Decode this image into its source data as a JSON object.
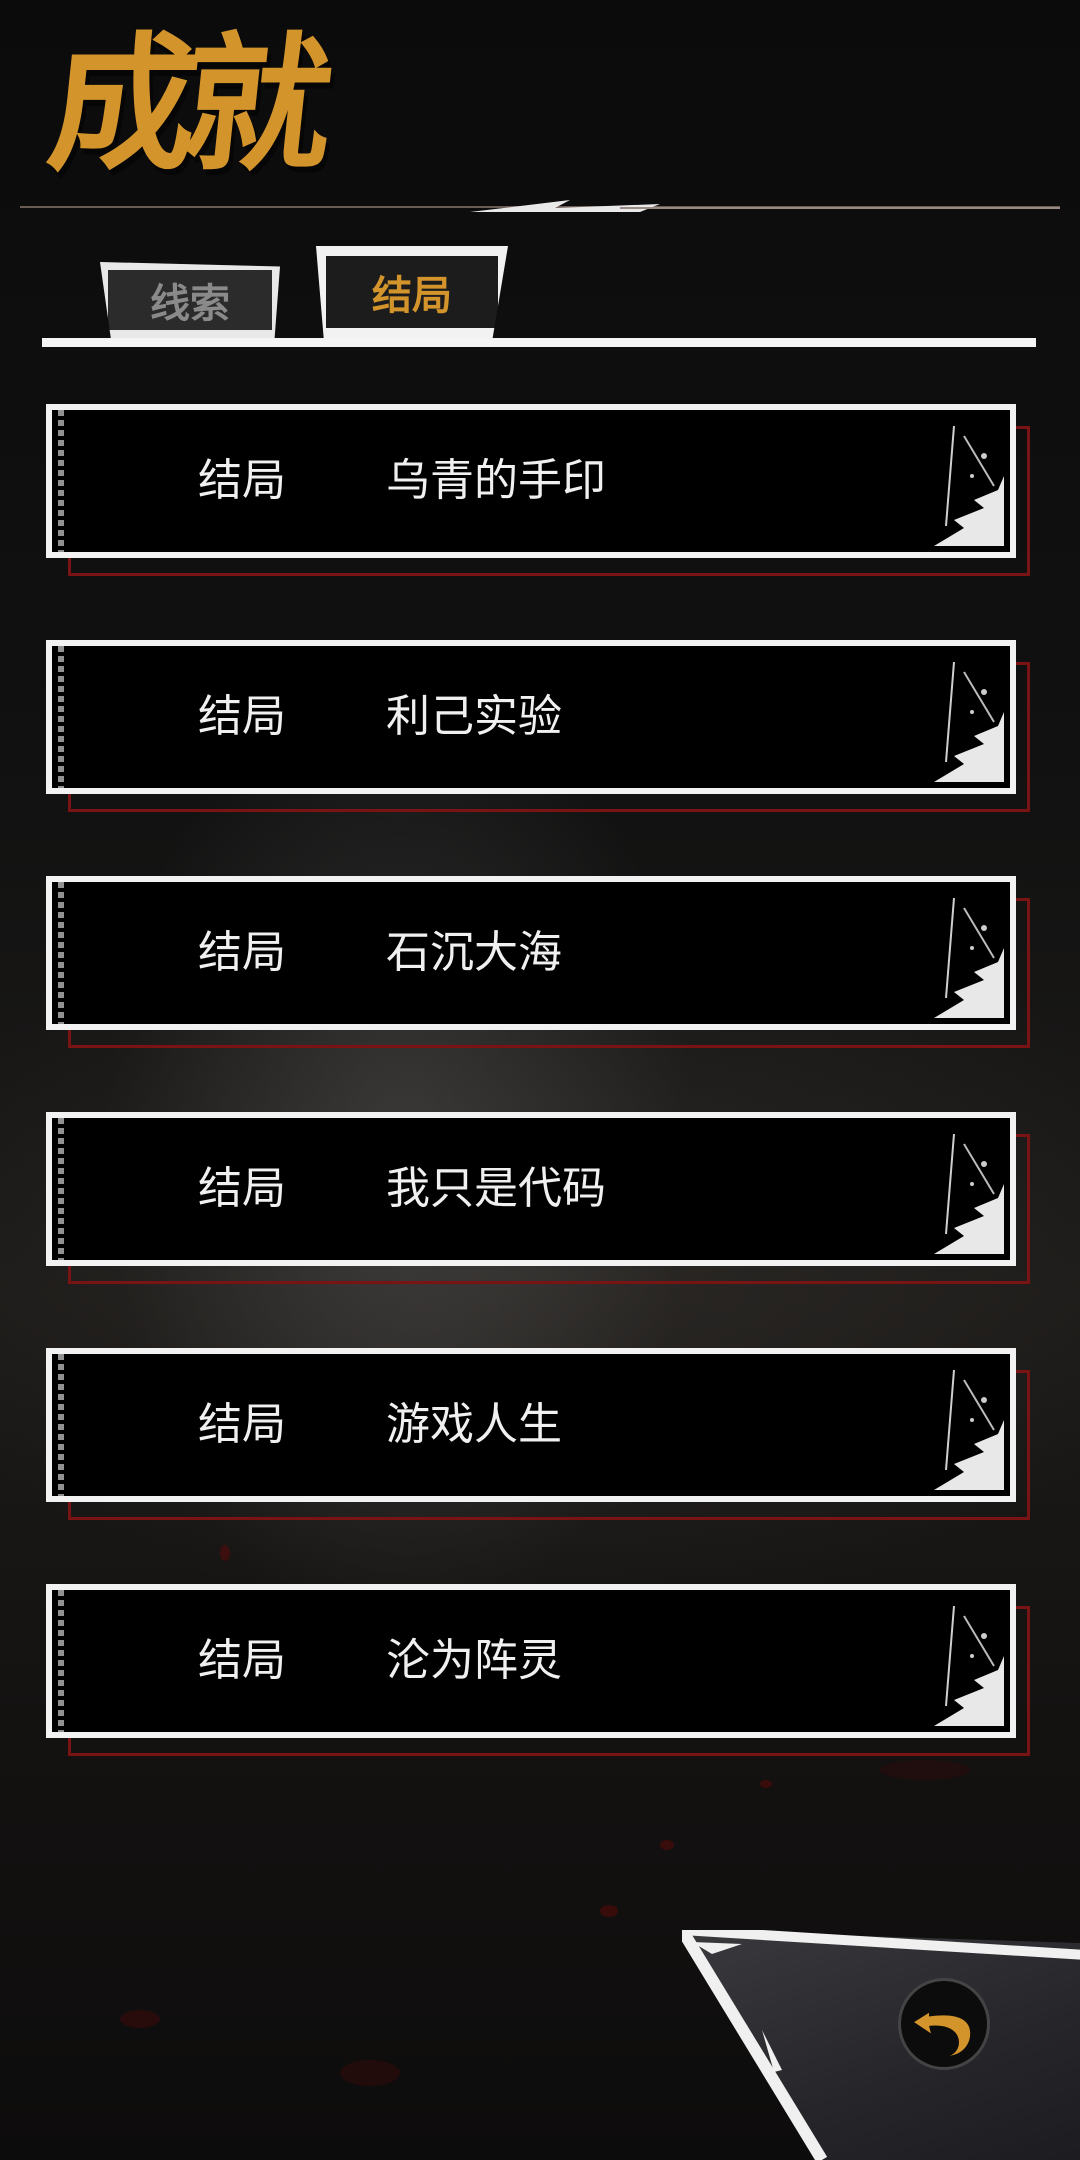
{
  "header": {
    "title": "成就"
  },
  "tabs": [
    {
      "label": "线索",
      "active": false
    },
    {
      "label": "结局",
      "active": true
    }
  ],
  "endings": [
    {
      "kind": "结局",
      "name": "乌青的手印"
    },
    {
      "kind": "结局",
      "name": "利己实验"
    },
    {
      "kind": "结局",
      "name": "石沉大海"
    },
    {
      "kind": "结局",
      "name": "我只是代码"
    },
    {
      "kind": "结局",
      "name": "游戏人生"
    },
    {
      "kind": "结局",
      "name": "沦为阵灵"
    }
  ],
  "colors": {
    "accent": "#d4942c",
    "frame": "#f2f2f2",
    "blood": "#7a1414"
  },
  "icons": {
    "back": "back-arrow-icon"
  }
}
